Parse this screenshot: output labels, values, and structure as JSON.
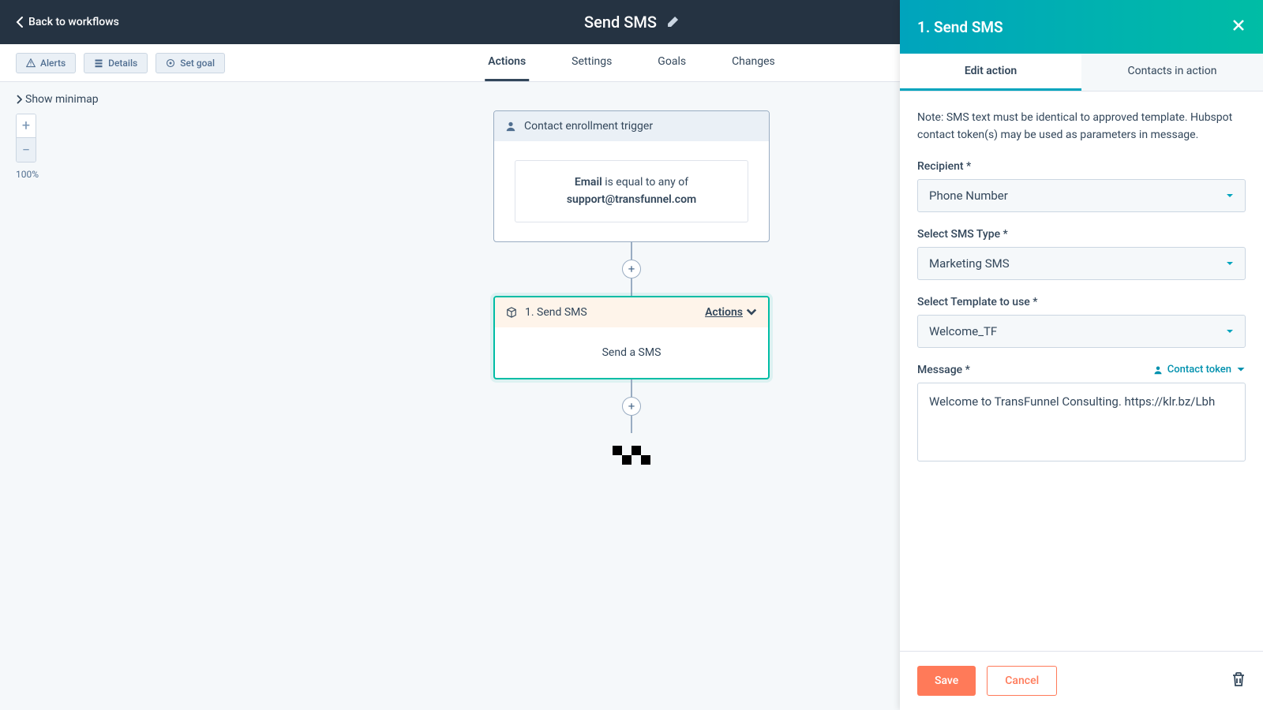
{
  "header": {
    "back_label": "Back to workflows",
    "workflow_title": "Send SMS"
  },
  "toolbar": {
    "alerts": "Alerts",
    "details": "Details",
    "set_goal": "Set goal"
  },
  "tabs": {
    "actions": "Actions",
    "settings": "Settings",
    "goals": "Goals",
    "changes": "Changes"
  },
  "minimap": {
    "show_label": "Show minimap",
    "zoom_percent": "100%"
  },
  "trigger": {
    "header": "Contact enrollment trigger",
    "prop": "Email",
    "middle": " is equal to any of ",
    "value": "support@transfunnel.com"
  },
  "action_node": {
    "title": "1. Send SMS",
    "actions_link": "Actions",
    "body": "Send a SMS"
  },
  "panel": {
    "title": "1. Send SMS",
    "tab_edit": "Edit action",
    "tab_contacts": "Contacts in action",
    "note": "Note: SMS text must be identical to approved template. Hubspot contact token(s) may be used as parameters in message.",
    "recipient_label": "Recipient *",
    "recipient_value": "Phone Number",
    "sms_type_label": "Select SMS Type *",
    "sms_type_value": "Marketing SMS",
    "template_label": "Select Template to use *",
    "template_value": "Welcome_TF",
    "message_label": "Message *",
    "contact_token": "Contact token",
    "message_value": "Welcome to TransFunnel Consulting. https://klr.bz/Lbh",
    "save": "Save",
    "cancel": "Cancel"
  }
}
